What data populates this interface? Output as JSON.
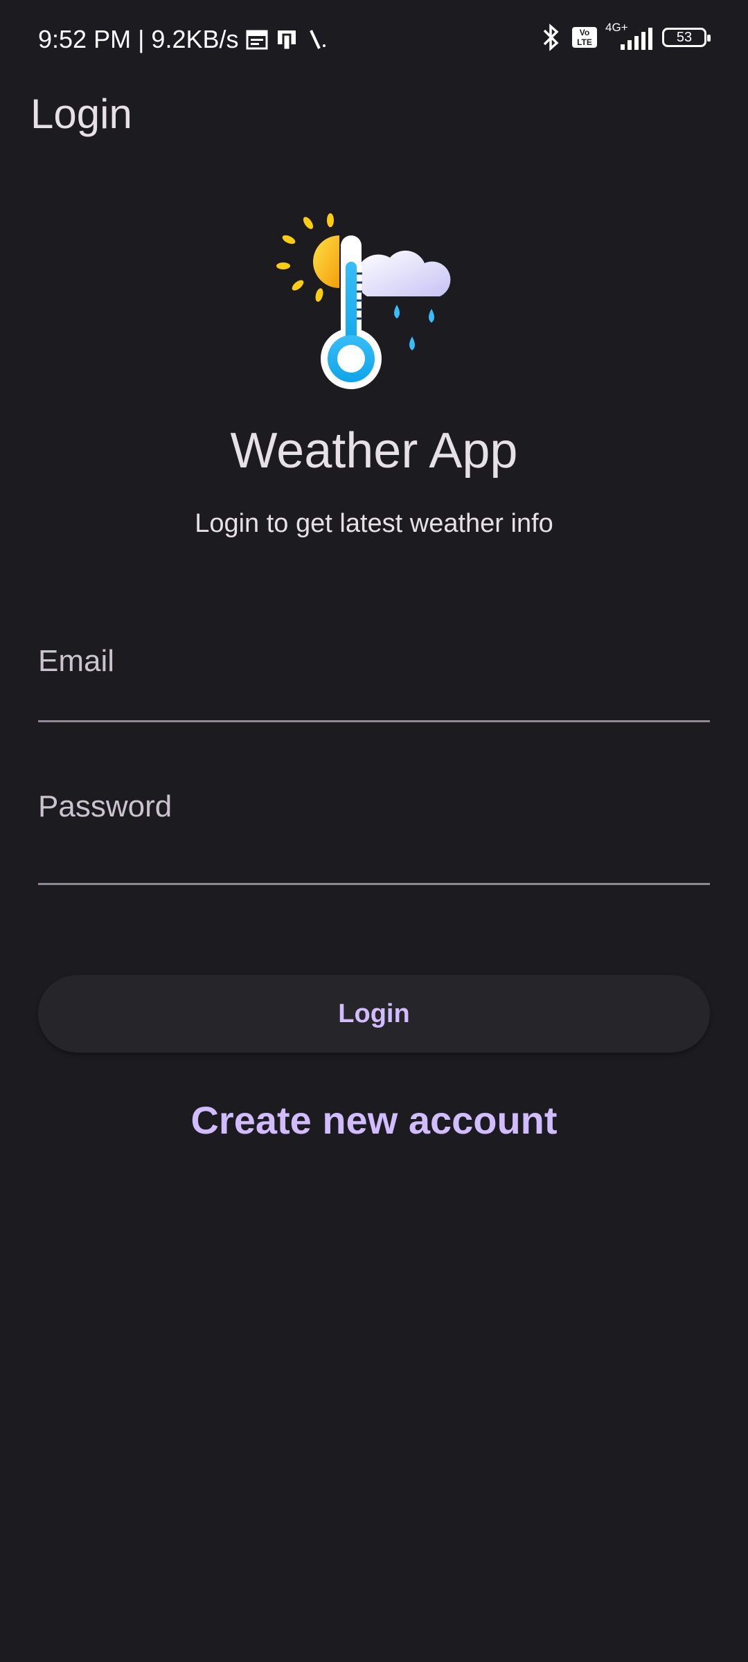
{
  "status_bar": {
    "time_speed": "9:52 PM | 9.2KB/s",
    "network": "4G+",
    "volte": "Vo LTE",
    "battery": "53"
  },
  "appbar": {
    "title": "Login"
  },
  "logo": {
    "icon": "weather-thermometer-sun-cloud-icon"
  },
  "hero": {
    "title": "Weather App",
    "subtitle": "Login to get latest weather info"
  },
  "form": {
    "email_placeholder": "Email",
    "password_placeholder": "Password",
    "login_label": "Login",
    "create_account_label": "Create new account"
  },
  "colors": {
    "background": "#1c1b1f",
    "accent": "#d0bcff",
    "button_bg": "#26252a"
  }
}
